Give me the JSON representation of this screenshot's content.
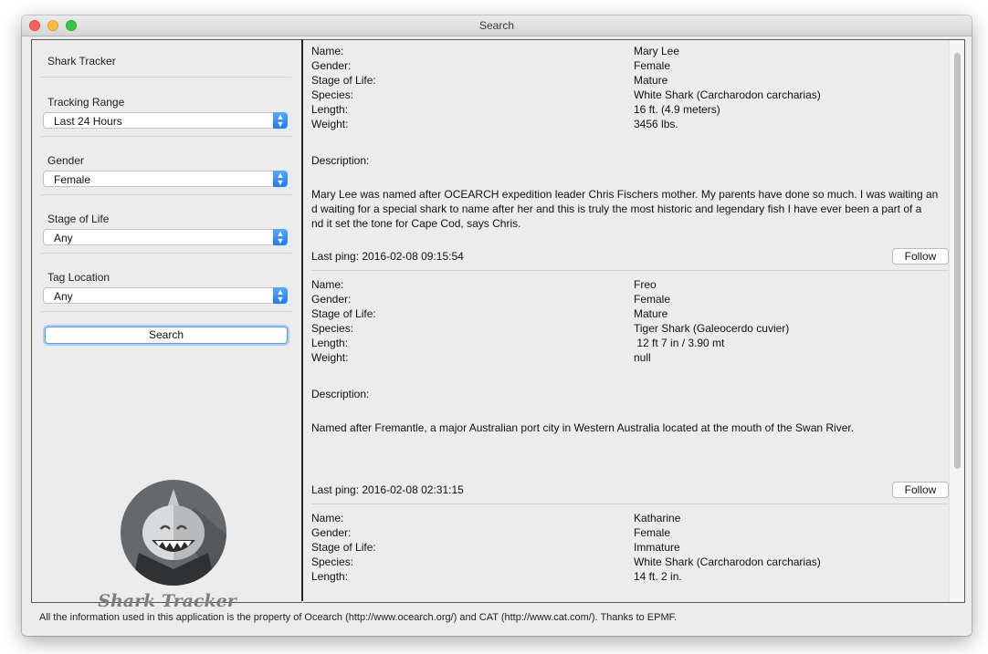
{
  "window": {
    "title": "Search"
  },
  "sidebar": {
    "app_name": "Shark Tracker",
    "tracking_range": {
      "label": "Tracking Range",
      "value": "Last 24 Hours"
    },
    "gender": {
      "label": "Gender",
      "value": "Female"
    },
    "stage_of_life": {
      "label": "Stage of Life",
      "value": "Any"
    },
    "tag_location": {
      "label": "Tag Location",
      "value": "Any"
    },
    "search_label": "Search",
    "logo_text": "Shark Tracker"
  },
  "labels": {
    "name": "Name:",
    "gender": "Gender:",
    "stage": "Stage of Life:",
    "species": "Species:",
    "length": "Length:",
    "weight": "Weight:",
    "description": "Description:",
    "follow": "Follow"
  },
  "sharks": [
    {
      "name": "Mary Lee",
      "gender": "Female",
      "stage": "Mature",
      "species": "White Shark (Carcharodon carcharias)",
      "length": "16 ft. (4.9 meters)",
      "weight": "3456 lbs.",
      "description_lines": [
        "Mary Lee was named after OCEARCH expedition leader Chris Fischers mother. My parents have done so much. I was waiting an",
        "d waiting for a special shark to name after her and this is truly the most historic and legendary fish I have ever been a part of a",
        "nd it set the tone for Cape Cod, says Chris."
      ],
      "last_ping": "Last ping: 2016-02-08 09:15:54"
    },
    {
      "name": "Freo",
      "gender": "Female",
      "stage": "Mature",
      "species": "Tiger Shark  (Galeocerdo cuvier)",
      "length": " 12 ft 7 in / 3.90 mt",
      "weight": "null",
      "description_lines": [
        "Named after Fremantle, a major Australian port city in Western Australia located at the mouth of the Swan River."
      ],
      "last_ping": "Last ping: 2016-02-08 02:31:15"
    },
    {
      "name": "Katharine",
      "gender": "Female",
      "stage": "Immature",
      "species": "White Shark (Carcharodon carcharias)",
      "length": "14 ft. 2 in."
    }
  ],
  "footer": "All the information used in this application is the property of Ocearch (http://www.ocearch.org/) and CAT (http://www.cat.com/). Thanks to EPMF.",
  "colors": {
    "accent": "#1e7cf5",
    "divider": "#222222"
  }
}
